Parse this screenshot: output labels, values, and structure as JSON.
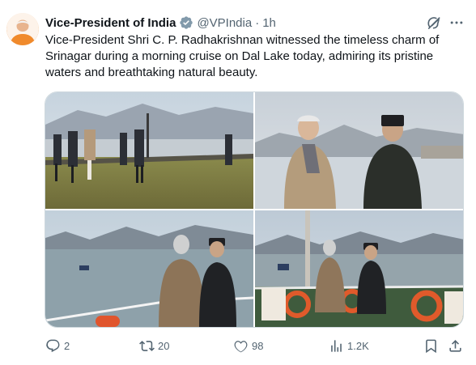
{
  "author": {
    "display_name": "Vice-President of India",
    "handle": "@VPIndia",
    "separator": "·",
    "time": "1h",
    "verified_color": "#829aab"
  },
  "tweet": {
    "text": "Vice-President Shri C. P. Radhakrishnan witnessed the timeless charm of Srinagar during a morning cruise on Dal Lake today, admiring its pristine waters and breathtaking natural beauty."
  },
  "media": {
    "photos": [
      {
        "subject": "group walking on lakeside lawn"
      },
      {
        "subject": "two men in conversation by the lake"
      },
      {
        "subject": "two men viewing the lake from boat railing"
      },
      {
        "subject": "two men on boat deck with life rings"
      }
    ]
  },
  "actions": {
    "replies": "2",
    "reposts": "20",
    "likes": "98",
    "views": "1.2K"
  },
  "colors": {
    "text": "#0f1419",
    "secondary": "#536471",
    "border": "#cfd9de"
  }
}
